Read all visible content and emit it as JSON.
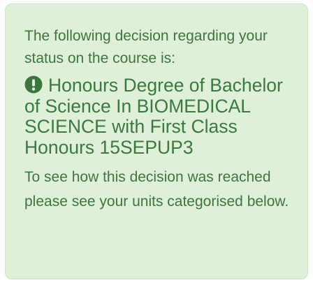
{
  "status_panel": {
    "intro_text": "The following decision regarding your status on the course is:",
    "alert_icon": "exclamation-circle-icon",
    "decision_text": "Honours Degree of Bachelor of Science In BIOMEDICAL SCIENCE with First Class Honours 15SEPUP3",
    "explanation_text": "To see how this decision was reached please see your units categorised below."
  },
  "colors": {
    "panel_background": "#dff0d8",
    "text": "#3c763d"
  }
}
